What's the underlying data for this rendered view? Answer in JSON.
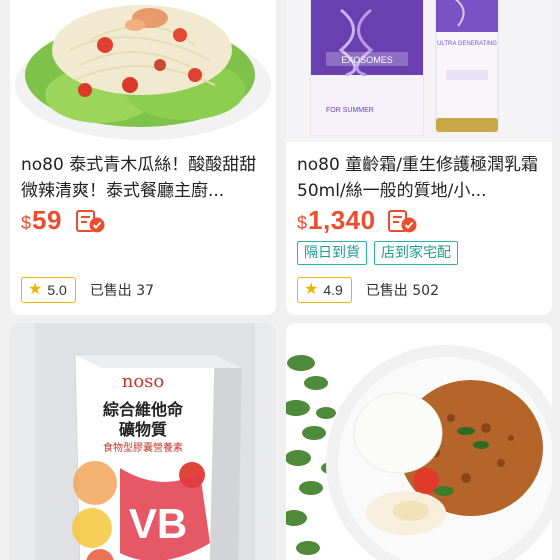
{
  "products": [
    {
      "title": "no80 泰式青木瓜絲！酸酸甜甜微辣清爽！泰式餐廳主廚...",
      "currency": "$",
      "price": "59",
      "tags": [],
      "rating": "5.0",
      "sold": "已售出 37",
      "image": "papaya-salad-image"
    },
    {
      "title": "no80 童齡霜/重生修護極潤乳霜 50ml/絲一般的質地/小...",
      "currency": "$",
      "price": "1,340",
      "tags": [
        "隔日到貨",
        "店到家宅配"
      ],
      "rating": "4.9",
      "sold": "已售出 502",
      "image": "skincare-cream-image",
      "box_text": "EXOSOMES",
      "box_subtext": "FOR SUMMER",
      "tube_text": "ULTRA GENERATING"
    },
    {
      "image": "vitamin-box-image",
      "brand": "noso",
      "box_title_1": "綜合維他命",
      "box_title_2": "礦物質",
      "box_subtitle": "食物型膠囊營養素",
      "box_badge": "VB"
    },
    {
      "image": "curry-rice-image"
    }
  ],
  "colors": {
    "price": "#ee4d2d",
    "tag": "#2bb3a5",
    "star": "#f0b400"
  }
}
